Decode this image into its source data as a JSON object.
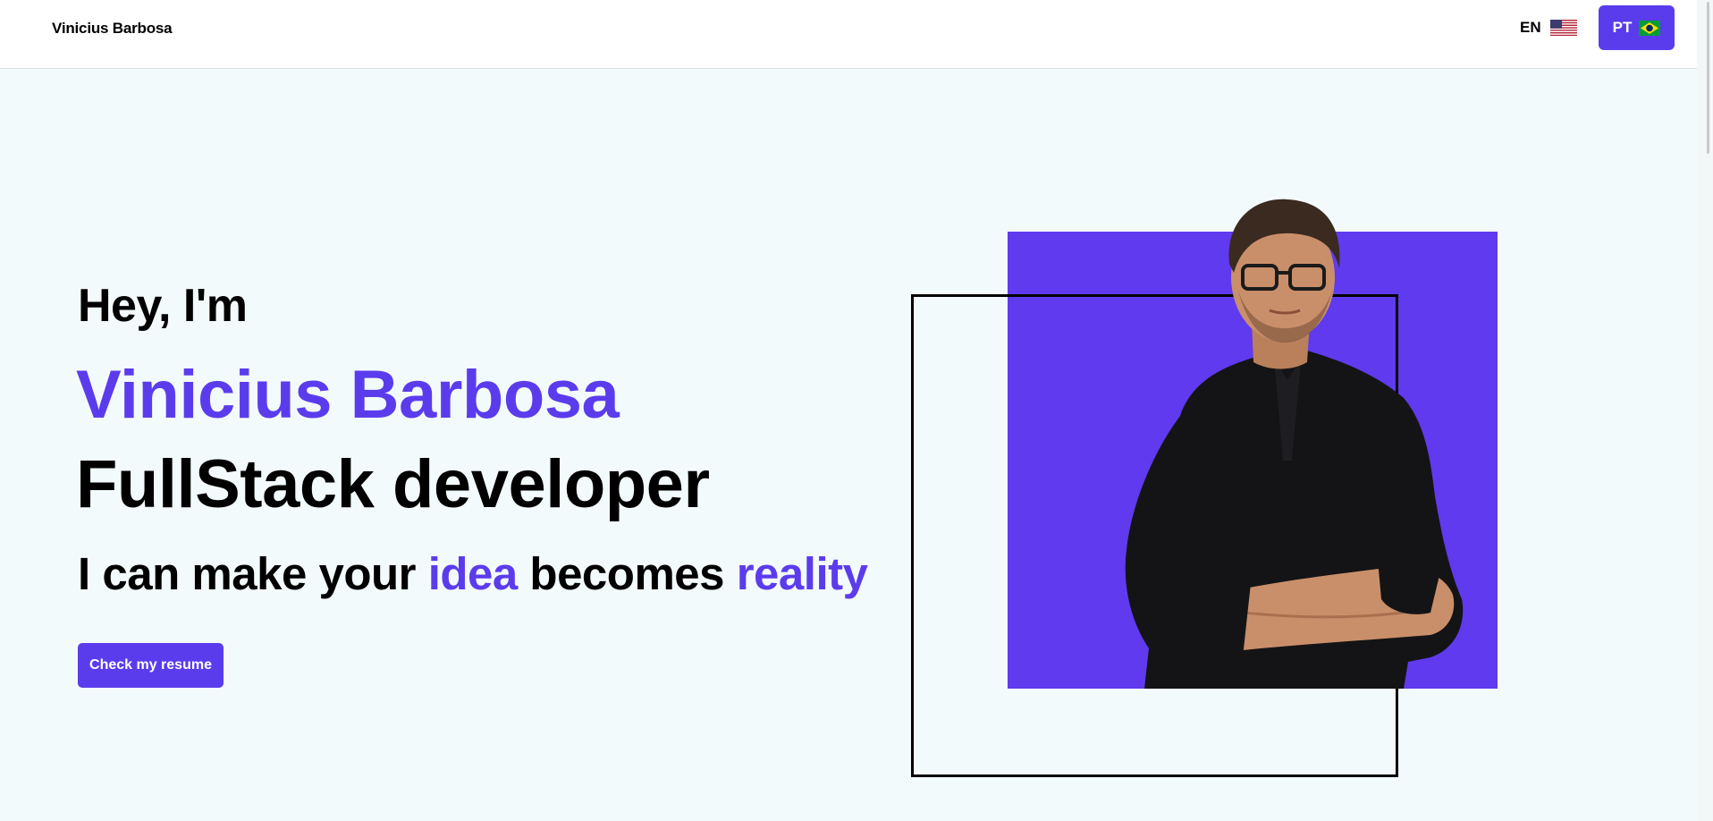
{
  "header": {
    "brand": "Vinicius Barbosa",
    "lang_en": "EN",
    "lang_pt": "PT",
    "en_flag_icon": "us-flag-icon",
    "pt_flag_icon": "brazil-flag-icon"
  },
  "hero": {
    "greeting": "Hey, I'm",
    "name": "Vinicius Barbosa",
    "role": "FullStack developer",
    "tagline_part1": "I can make your ",
    "tagline_highlight1": "idea",
    "tagline_part2": " becomes ",
    "tagline_highlight2": "reality",
    "resume_button": "Check my resume"
  },
  "colors": {
    "accent": "#5b3ced",
    "background": "#f3fafb",
    "header_bg": "#ffffff"
  }
}
